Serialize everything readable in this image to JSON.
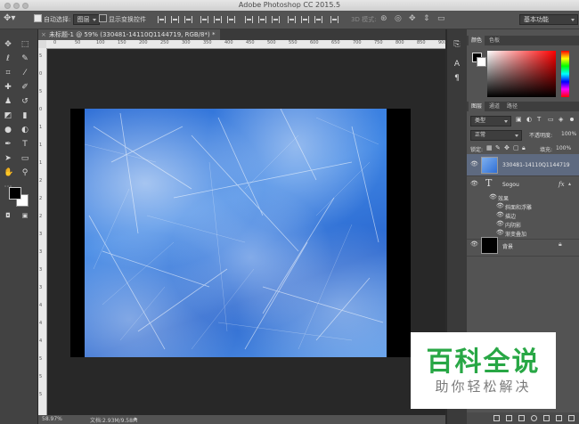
{
  "window": {
    "title": "Adobe Photoshop CC 2015.5"
  },
  "options_bar": {
    "auto_select_label": "自动选择:",
    "auto_select_value": "图层",
    "show_transform_label": "显示变换控件",
    "mode_3d_label": "3D 模式:",
    "workspace": "基本功能"
  },
  "document": {
    "tab_label": "未标题-1 @ 59% (330481-14110Q1144719, RGB/8*) *",
    "zoom": "58.97%",
    "doc_size": "文档:2.93M/9.58M"
  },
  "ruler": {
    "h_ticks": [
      "0",
      "50",
      "100",
      "150",
      "200",
      "250",
      "300",
      "350",
      "400",
      "450",
      "500",
      "550",
      "600",
      "650",
      "700",
      "750",
      "800",
      "850",
      "900"
    ],
    "v_ticks": [
      "5",
      "0",
      "5",
      "0",
      "1",
      "1",
      "1",
      "2",
      "2",
      "2",
      "3",
      "3",
      "3",
      "3",
      "4",
      "4",
      "4",
      "5",
      "5",
      "5"
    ]
  },
  "color_panel": {
    "tabs": [
      "颜色",
      "色板"
    ]
  },
  "layers_panel": {
    "tabs": [
      "图层",
      "通道",
      "路径"
    ],
    "filter_kind": "类型",
    "blend_mode": "正常",
    "opacity_label": "不透明度:",
    "opacity_value": "100%",
    "lock_label": "锁定:",
    "fill_label": "填充:",
    "fill_value": "100%",
    "layers": [
      {
        "name": "330481-14110Q1144719"
      },
      {
        "name": "Sogou",
        "fx": "fx"
      },
      {
        "name": "背景"
      }
    ],
    "effects_label": "效果",
    "effects": [
      "斜面和浮雕",
      "描边",
      "内阴影",
      "渐变叠加"
    ]
  },
  "watermark": {
    "title": "百科全说",
    "subtitle": "助你轻松解决"
  },
  "colors": {
    "panel": "#535353",
    "canvas_bg": "#282828",
    "ice_blue": "#3f86e4",
    "watermark_green": "#28a745"
  }
}
